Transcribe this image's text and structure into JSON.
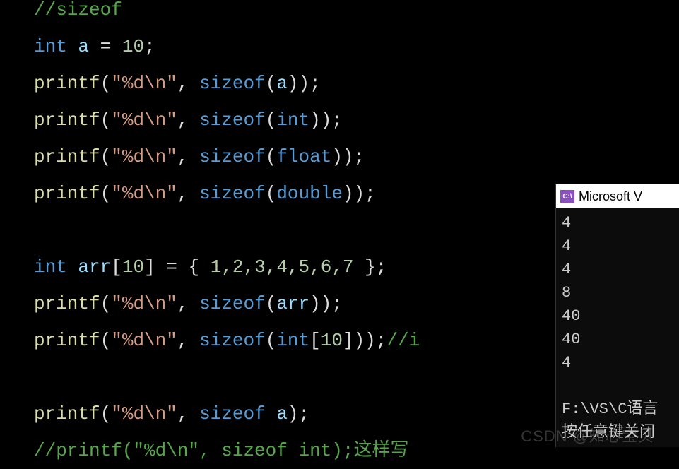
{
  "code": {
    "line1": {
      "comment": "//sizeof"
    },
    "line2": {
      "kw_int": "int",
      "var": "a",
      "eq": " = ",
      "num": "10",
      "semi": ";"
    },
    "line3": {
      "fn": "printf",
      "str": "\"%d\\n\"",
      "comma": ", ",
      "kw": "sizeof",
      "arg": "a"
    },
    "line4": {
      "fn": "printf",
      "str": "\"%d\\n\"",
      "comma": ", ",
      "kw": "sizeof",
      "arg": "int"
    },
    "line5": {
      "fn": "printf",
      "str": "\"%d\\n\"",
      "comma": ", ",
      "kw": "sizeof",
      "arg": "float"
    },
    "line6": {
      "fn": "printf",
      "str": "\"%d\\n\"",
      "comma": ", ",
      "kw": "sizeof",
      "arg": "double"
    },
    "line7": {
      "kw_int": "int",
      "var": "arr",
      "bracket_open": "[",
      "size": "10",
      "bracket_close": "]",
      "eq": " = ",
      "brace_open": "{ ",
      "vals": "1,2,3,4,5,6,7",
      "brace_close": " }",
      "semi": ";"
    },
    "line8": {
      "fn": "printf",
      "str": "\"%d\\n\"",
      "comma": ", ",
      "kw": "sizeof",
      "arg": "arr"
    },
    "line9": {
      "fn": "printf",
      "str": "\"%d\\n\"",
      "comma": ", ",
      "kw": "sizeof",
      "arg_type": "int",
      "bracket_open": "[",
      "size": "10",
      "bracket_close": "]",
      "comment": "//i"
    },
    "line10": {
      "fn": "printf",
      "str": "\"%d\\n\"",
      "comma": ", ",
      "kw": "sizeof",
      "arg": "a"
    },
    "line11": {
      "comment_prefix": "//printf(\"%d\\n\", sizeof int);",
      "chinese": "这样写"
    }
  },
  "console": {
    "title": "Microsoft V",
    "output": [
      "4",
      "4",
      "4",
      "8",
      "40",
      "40",
      "4"
    ],
    "path": "F:\\VS\\C语言",
    "prompt": "按任意键关闭"
  },
  "watermark": "CSDN @知心宝贝"
}
